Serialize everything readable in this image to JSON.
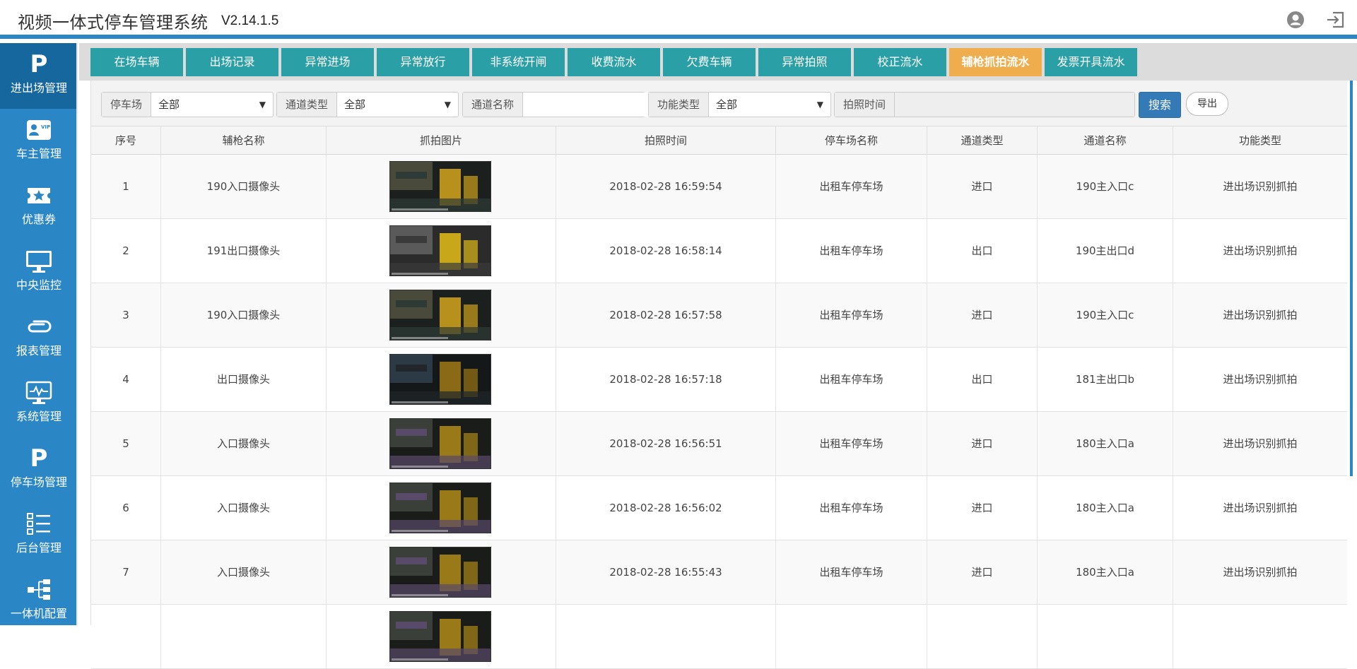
{
  "header": {
    "title": "视频一体式停车管理系统",
    "version": "V2.14.1.5",
    "user_icon": "user-circle-icon",
    "logout_icon": "logout-icon"
  },
  "sidebar": {
    "items": [
      {
        "label": "进出场管理",
        "icon": "parking-p-icon",
        "active": true
      },
      {
        "label": "车主管理",
        "icon": "vip-card-icon"
      },
      {
        "label": "优惠券",
        "icon": "coupon-star-icon"
      },
      {
        "label": "中央监控",
        "icon": "monitor-icon"
      },
      {
        "label": "报表管理",
        "icon": "paperclip-icon"
      },
      {
        "label": "系统管理",
        "icon": "system-monitor-icon"
      },
      {
        "label": "停车场管理",
        "icon": "parking-p-icon"
      },
      {
        "label": "后台管理",
        "icon": "list-icon"
      },
      {
        "label": "一体机配置",
        "icon": "network-tree-icon"
      }
    ]
  },
  "tabs": [
    {
      "label": "在场车辆"
    },
    {
      "label": "出场记录"
    },
    {
      "label": "异常进场"
    },
    {
      "label": "异常放行"
    },
    {
      "label": "非系统开闸"
    },
    {
      "label": "收费流水"
    },
    {
      "label": "欠费车辆"
    },
    {
      "label": "异常拍照"
    },
    {
      "label": "校正流水"
    },
    {
      "label": "辅枪抓拍流水",
      "active": true
    },
    {
      "label": "发票开具流水"
    }
  ],
  "filters": {
    "parking_label": "停车场",
    "parking_value": "全部",
    "channel_type_label": "通道类型",
    "channel_type_value": "全部",
    "channel_name_label": "通道名称",
    "channel_name_value": "",
    "function_type_label": "功能类型",
    "function_type_value": "全部",
    "photo_time_label": "拍照时间",
    "photo_time_value": "",
    "search_label": "搜索",
    "export_label": "导出"
  },
  "table": {
    "headers": [
      "序号",
      "辅枪名称",
      "抓拍图片",
      "拍照时间",
      "停车场名称",
      "通道类型",
      "通道名称",
      "功能类型"
    ],
    "rows": [
      {
        "no": "1",
        "camera": "190入口摄像头",
        "time": "2018-02-28 16:59:54",
        "lot": "出租车停车场",
        "type": "进口",
        "channel": "190主入口c",
        "func": "进出场识别抓拍"
      },
      {
        "no": "2",
        "camera": "191出口摄像头",
        "time": "2018-02-28 16:58:14",
        "lot": "出租车停车场",
        "type": "出口",
        "channel": "190主出口d",
        "func": "进出场识别抓拍"
      },
      {
        "no": "3",
        "camera": "190入口摄像头",
        "time": "2018-02-28 16:57:58",
        "lot": "出租车停车场",
        "type": "进口",
        "channel": "190主入口c",
        "func": "进出场识别抓拍"
      },
      {
        "no": "4",
        "camera": "出口摄像头",
        "time": "2018-02-28 16:57:18",
        "lot": "出租车停车场",
        "type": "出口",
        "channel": "181主出口b",
        "func": "进出场识别抓拍"
      },
      {
        "no": "5",
        "camera": "入口摄像头",
        "time": "2018-02-28 16:56:51",
        "lot": "出租车停车场",
        "type": "进口",
        "channel": "180主入口a",
        "func": "进出场识别抓拍"
      },
      {
        "no": "6",
        "camera": "入口摄像头",
        "time": "2018-02-28 16:56:02",
        "lot": "出租车停车场",
        "type": "进口",
        "channel": "180主入口a",
        "func": "进出场识别抓拍"
      },
      {
        "no": "7",
        "camera": "入口摄像头",
        "time": "2018-02-28 16:55:43",
        "lot": "出租车停车场",
        "type": "进口",
        "channel": "180主入口a",
        "func": "进出场识别抓拍"
      },
      {
        "no": "",
        "camera": "",
        "time": "",
        "lot": "",
        "type": "",
        "channel": "",
        "func": ""
      }
    ]
  },
  "colors": {
    "sidebar": "#2a86c5",
    "sidebar_active": "#17679f",
    "tab": "#2aa0a6",
    "tab_active": "#f0ad4e",
    "search_button": "#337ab7"
  }
}
